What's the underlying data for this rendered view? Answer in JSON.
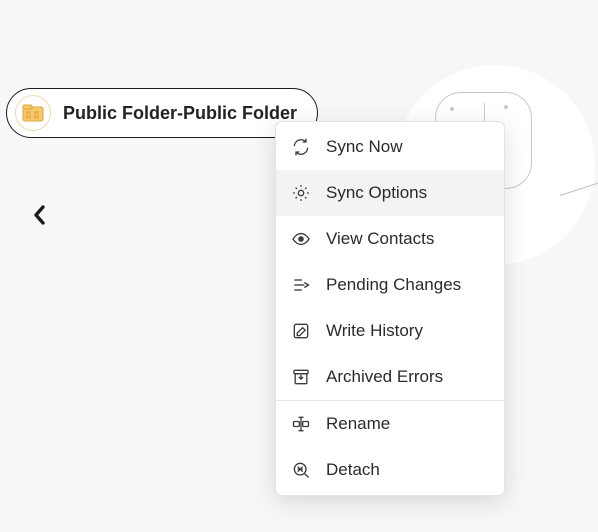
{
  "chip": {
    "title": "Public Folder-Public Folder"
  },
  "menu": {
    "items": [
      {
        "label": "Sync Now",
        "icon": "sync-now-icon"
      },
      {
        "label": "Sync Options",
        "icon": "gear-icon",
        "highlighted": true
      },
      {
        "label": "View Contacts",
        "icon": "eye-icon"
      },
      {
        "label": "Pending Changes",
        "icon": "pending-icon"
      },
      {
        "label": "Write History",
        "icon": "edit-icon"
      },
      {
        "label": "Archived Errors",
        "icon": "archive-icon"
      }
    ],
    "footer_items": [
      {
        "label": "Rename",
        "icon": "rename-icon"
      },
      {
        "label": "Detach",
        "icon": "detach-icon"
      }
    ]
  }
}
